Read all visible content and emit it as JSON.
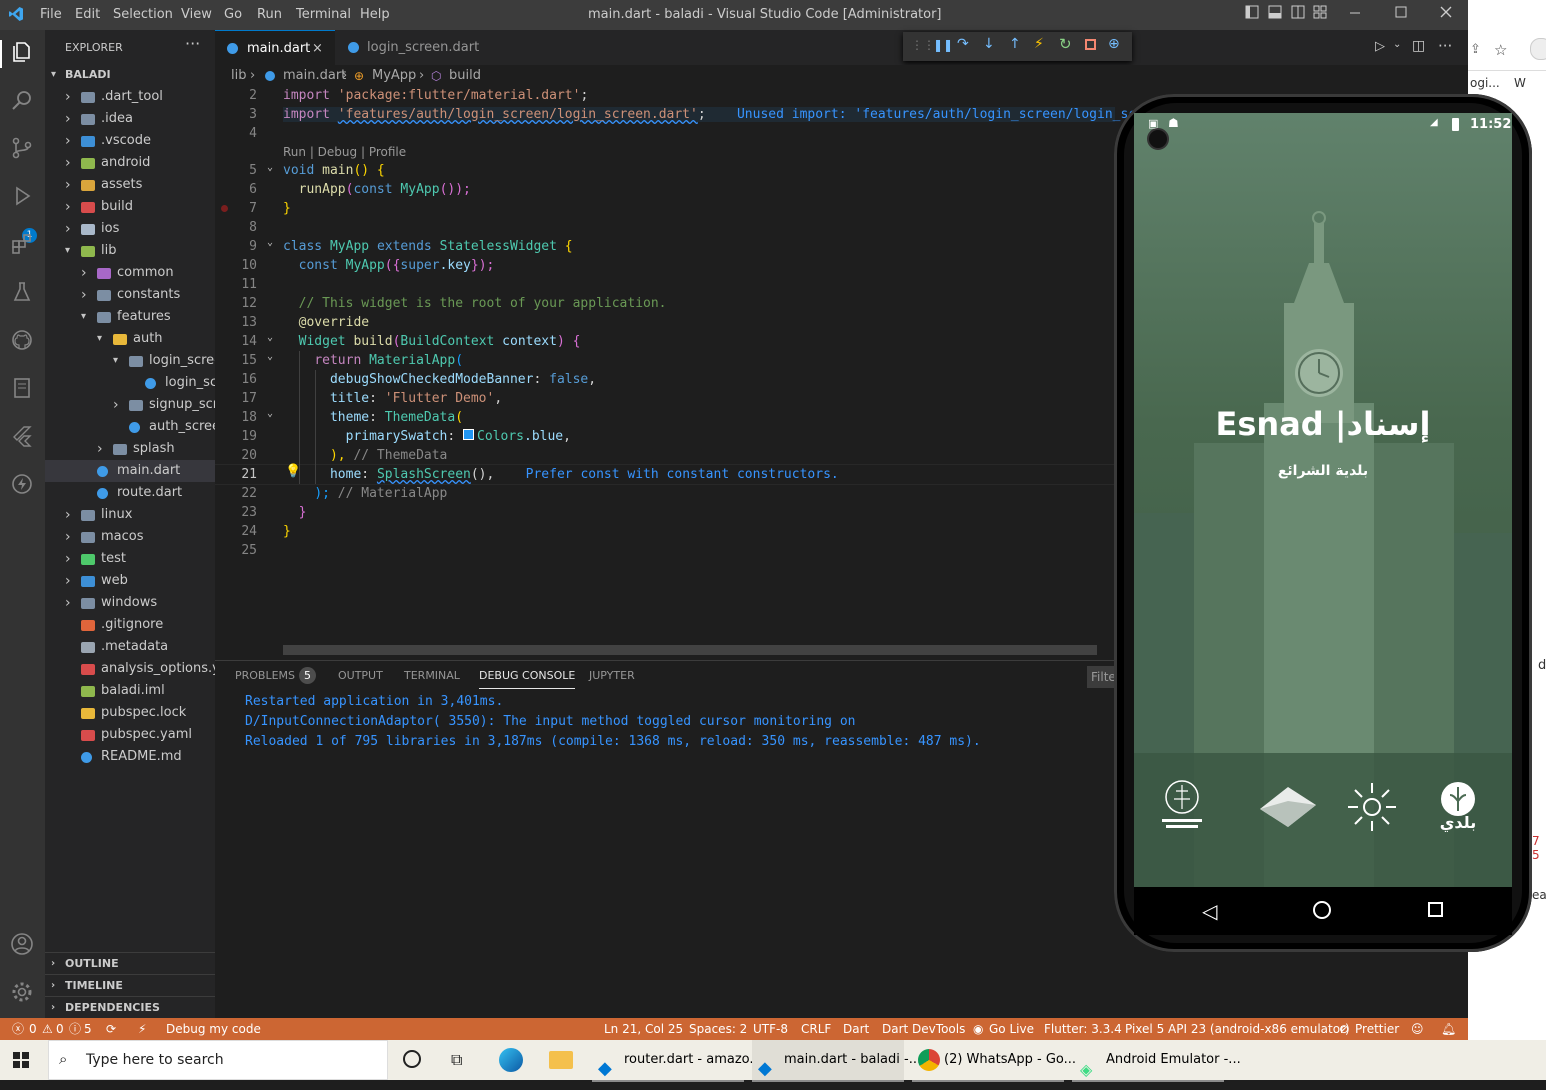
{
  "window": {
    "title": "main.dart - baladi - Visual Studio Code [Administrator]",
    "menu": [
      "File",
      "Edit",
      "Selection",
      "View",
      "Go",
      "Run",
      "Terminal",
      "Help"
    ]
  },
  "activity": {
    "debug_badge": "1"
  },
  "sidebar": {
    "header": "EXPLORER",
    "root": "BALADI",
    "items": [
      {
        "label": ".dart_tool"
      },
      {
        "label": ".idea"
      },
      {
        "label": ".vscode"
      },
      {
        "label": "android"
      },
      {
        "label": "assets"
      },
      {
        "label": "build"
      },
      {
        "label": "ios"
      },
      {
        "label": "lib"
      },
      {
        "label": "common"
      },
      {
        "label": "constants"
      },
      {
        "label": "features"
      },
      {
        "label": "auth"
      },
      {
        "label": "login_screen"
      },
      {
        "label": "login_screen..."
      },
      {
        "label": "signup_screen"
      },
      {
        "label": "auth_screen.d..."
      },
      {
        "label": "splash"
      },
      {
        "label": "main.dart"
      },
      {
        "label": "route.dart"
      },
      {
        "label": "linux"
      },
      {
        "label": "macos"
      },
      {
        "label": "test"
      },
      {
        "label": "web"
      },
      {
        "label": "windows"
      },
      {
        "label": ".gitignore"
      },
      {
        "label": ".metadata"
      },
      {
        "label": "analysis_options.y..."
      },
      {
        "label": "baladi.iml"
      },
      {
        "label": "pubspec.lock"
      },
      {
        "label": "pubspec.yaml"
      },
      {
        "label": "README.md"
      }
    ],
    "sections": [
      "OUTLINE",
      "TIMELINE",
      "DEPENDENCIES"
    ]
  },
  "tabs": [
    {
      "label": "main.dart"
    },
    {
      "label": "login_screen.dart"
    }
  ],
  "breadcrumb": {
    "a": "lib",
    "b": "main.dart",
    "c": "MyApp",
    "d": "build"
  },
  "editor": {
    "line_numbers": [
      "2",
      "3",
      "4",
      "5",
      "6",
      "7",
      "8",
      "9",
      "10",
      "11",
      "12",
      "13",
      "14",
      "15",
      "16",
      "17",
      "18",
      "19",
      "20",
      "21",
      "22",
      "23",
      "24",
      "25"
    ],
    "code_lens": "Run | Debug | Profile",
    "line2": {
      "kw": "import",
      "str": "'package:flutter/material.dart'",
      "end": ";"
    },
    "line3": {
      "kw": "import",
      "str": "'features/auth/login_screen/login_screen.dart'",
      "end": ";",
      "hint": "Unused import: 'features/auth/login_screen/login_sc"
    },
    "line5": {
      "kw": "void",
      "fn": "main",
      "rest": "() {"
    },
    "line6": {
      "fn": "runApp",
      "p1": "(",
      "kw": "const",
      "ty": "MyApp",
      "p2": "());"
    },
    "line7": {
      "text": "}"
    },
    "line9": {
      "kw1": "class",
      "ty1": "MyApp",
      "kw2": "extends",
      "ty2": "StatelessWidget",
      "rest": " {"
    },
    "line10": {
      "kw": "const",
      "ty": "MyApp",
      "p1": "({",
      "kw2": "super",
      "vr": ".key",
      "p2": "});"
    },
    "line12": {
      "cm": "// This widget is the root of your application."
    },
    "line13": {
      "ann": "@override"
    },
    "line14": {
      "ty": "Widget",
      "fn": "build",
      "p1": "(",
      "ty2": "BuildContext",
      "vr": "context",
      "p2": ") {"
    },
    "line15": {
      "kw": "return",
      "ty": "MaterialApp",
      "p": "("
    },
    "line16": {
      "vr": "debugShowCheckedModeBanner",
      "p": ": ",
      "kw": "false",
      "end": ","
    },
    "line17": {
      "vr": "title",
      "p": ": ",
      "str": "'Flutter Demo'",
      "end": ","
    },
    "line18": {
      "vr": "theme",
      "p": ": ",
      "ty": "ThemeData",
      "end": "("
    },
    "line19": {
      "vr": "primarySwatch",
      "p": ": ",
      "ty": "Colors",
      "vr2": ".blue",
      "end": ","
    },
    "line20": {
      "p": "),",
      "cm": " // ThemeData"
    },
    "line21": {
      "vr": "home",
      "p": ": ",
      "ty": "SplashScreen",
      "end": "(),",
      "hint": "Prefer const with constant constructors."
    },
    "line22": {
      "p": ");",
      "cm": " // MaterialApp"
    },
    "line23": {
      "text": "}"
    },
    "line24": {
      "text": "}"
    }
  },
  "panel": {
    "tabs": [
      "PROBLEMS",
      "OUTPUT",
      "TERMINAL",
      "DEBUG CONSOLE",
      "JUPYTER"
    ],
    "problems_count": "5",
    "filter": "Filte",
    "lines": [
      "Restarted application in 3,401ms.",
      "D/InputConnectionAdaptor( 3550): The input method toggled cursor monitoring on",
      "Reloaded 1 of 795 libraries in 3,187ms (compile: 1368 ms, reload: 350 ms, reassemble: 487 ms)."
    ]
  },
  "statusbar": {
    "errors": "0",
    "warnings": "0",
    "infos": "5",
    "debug": "Debug my code",
    "position": "Ln 21, Col 25",
    "spaces": "Spaces: 2",
    "encoding": "UTF-8",
    "eol": "CRLF",
    "language": "Dart",
    "devtools": "Dart DevTools",
    "golive": "Go Live",
    "flutter": "Flutter: 3.3.4",
    "device": "Pixel 5 API 23 (android-x86 emulator)",
    "prettier": "Prettier"
  },
  "taskbar": {
    "search_placeholder": "Type here to search",
    "apps": [
      "router.dart - amazo...",
      "main.dart - baladi -...",
      "(2) WhatsApp - Go...",
      "Android Emulator -..."
    ]
  },
  "phone": {
    "time": "11:52",
    "app_title_en": "Esnad",
    "app_title_ar": "|إسناد",
    "subtitle_ar": "بلدية الشرائع",
    "logos": [
      "ministry-logo",
      "building-logo",
      "vision-logo",
      "baladi-logo"
    ],
    "baladi_text": "بلدي"
  },
  "background_window": {
    "snippet1": "ogi...",
    "snippet2": "W",
    "snippet3": "d",
    "snippet4": "7 5",
    "snippet5": "ea"
  },
  "colors": {
    "statusbar": "#cc6633",
    "accent": "#007acc",
    "phone_green": "#4b6b53"
  }
}
